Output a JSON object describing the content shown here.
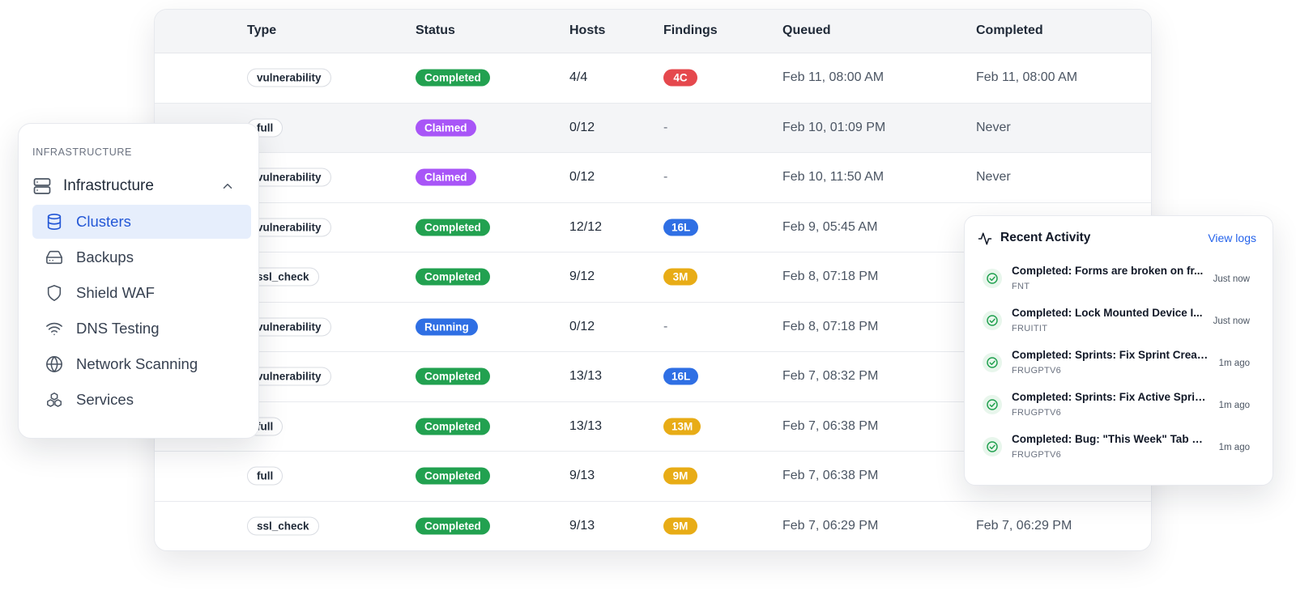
{
  "table": {
    "headers": {
      "type": "Type",
      "status": "Status",
      "hosts": "Hosts",
      "findings": "Findings",
      "queued": "Queued",
      "completed": "Completed"
    },
    "rows": [
      {
        "type": "vulnerability",
        "status": "Completed",
        "status_kind": "completed",
        "hosts": "4/4",
        "findings": "4C",
        "finding_kind": "c",
        "queued": "Feb 11, 08:00 AM",
        "completed": "Feb 11, 08:00 AM"
      },
      {
        "type": "full",
        "status": "Claimed",
        "status_kind": "claimed",
        "hosts": "0/12",
        "findings": "-",
        "finding_kind": "none",
        "queued": "Feb 10, 01:09 PM",
        "completed": "Never"
      },
      {
        "type": "vulnerability",
        "status": "Claimed",
        "status_kind": "claimed",
        "hosts": "0/12",
        "findings": "-",
        "finding_kind": "none",
        "queued": "Feb 10, 11:50 AM",
        "completed": "Never"
      },
      {
        "type": "vulnerability",
        "status": "Completed",
        "status_kind": "completed",
        "hosts": "12/12",
        "findings": "16L",
        "finding_kind": "l",
        "queued": "Feb 9, 05:45 AM",
        "completed": ""
      },
      {
        "type": "ssl_check",
        "status": "Completed",
        "status_kind": "completed",
        "hosts": "9/12",
        "findings": "3M",
        "finding_kind": "m",
        "queued": "Feb 8, 07:18 PM",
        "completed": ""
      },
      {
        "type": "vulnerability",
        "status": "Running",
        "status_kind": "running",
        "hosts": "0/12",
        "findings": "-",
        "finding_kind": "none",
        "queued": "Feb 8, 07:18 PM",
        "completed": ""
      },
      {
        "type": "vulnerability",
        "status": "Completed",
        "status_kind": "completed",
        "hosts": "13/13",
        "findings": "16L",
        "finding_kind": "l",
        "queued": "Feb 7, 08:32 PM",
        "completed": ""
      },
      {
        "type": "full",
        "status": "Completed",
        "status_kind": "completed",
        "hosts": "13/13",
        "findings": "13M",
        "finding_kind": "m",
        "queued": "Feb 7, 06:38 PM",
        "completed": ""
      },
      {
        "type": "full",
        "status": "Completed",
        "status_kind": "completed",
        "hosts": "9/13",
        "findings": "9M",
        "finding_kind": "m",
        "queued": "Feb 7, 06:38 PM",
        "completed": ""
      },
      {
        "type": "ssl_check",
        "status": "Completed",
        "status_kind": "completed",
        "hosts": "9/13",
        "findings": "9M",
        "finding_kind": "m",
        "queued": "Feb 7, 06:29 PM",
        "completed": "Feb 7, 06:29 PM"
      }
    ],
    "highlighted_row": 1
  },
  "sidebar": {
    "section_label": "INFRASTRUCTURE",
    "group": {
      "label": "Infrastructure",
      "icon": "server-icon",
      "expanded": true
    },
    "items": [
      {
        "label": "Clusters",
        "icon": "database-icon",
        "active": true
      },
      {
        "label": "Backups",
        "icon": "hard-drive-icon",
        "active": false
      },
      {
        "label": "Shield WAF",
        "icon": "shield-icon",
        "active": false
      },
      {
        "label": "DNS Testing",
        "icon": "wifi-icon",
        "active": false
      },
      {
        "label": "Network Scanning",
        "icon": "globe-icon",
        "active": false
      },
      {
        "label": "Services",
        "icon": "boxes-icon",
        "active": false
      }
    ]
  },
  "activity": {
    "title": "Recent Activity",
    "view_logs": "View logs",
    "items": [
      {
        "message": "Completed: Forms are broken on fr...",
        "project": "FNT",
        "time": "Just now"
      },
      {
        "message": "Completed: Lock Mounted Device I...",
        "project": "FRUITIT",
        "time": "Just now"
      },
      {
        "message": "Completed: Sprints: Fix Sprint Creati...",
        "project": "FRUGPTV6",
        "time": "1m ago"
      },
      {
        "message": "Completed: Sprints: Fix Active Sprint...",
        "project": "FRUGPTV6",
        "time": "1m ago"
      },
      {
        "message": "Completed: Bug: \"This Week\" Tab Br...",
        "project": "FRUGPTV6",
        "time": "1m ago"
      }
    ]
  },
  "colors": {
    "status_completed": "#22a150",
    "status_claimed": "#a855f7",
    "status_running": "#2f6fe4",
    "finding_critical": "#e5484d",
    "finding_low": "#2f6fe4",
    "finding_medium": "#e8ac16",
    "accent": "#2357d6"
  }
}
